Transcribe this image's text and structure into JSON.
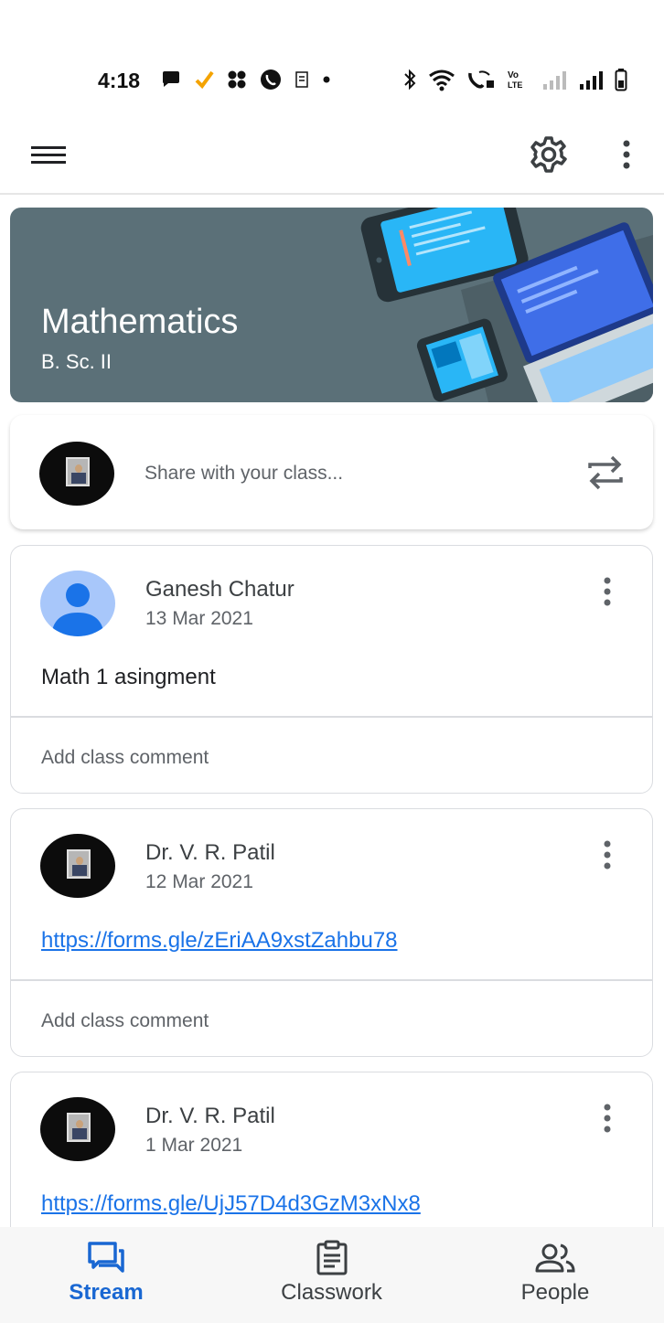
{
  "status_bar": {
    "time": "4:18",
    "left_icons": [
      "chat-bubble-icon",
      "check-icon",
      "app-grid-icon",
      "call-icon",
      "sim-icon",
      "dot-icon"
    ],
    "right_icons": [
      "bluetooth-icon",
      "wifi-icon",
      "wifi-calling-icon",
      "volte-icon",
      "signal-icon",
      "signal-icon",
      "battery-icon"
    ]
  },
  "app_bar": {
    "menu_icon": "hamburger-menu-icon",
    "settings_icon": "gear-icon",
    "more_icon": "more-vert-icon"
  },
  "class_banner": {
    "title": "Mathematics",
    "section": "B. Sc. II",
    "color": "#5b7078"
  },
  "share_box": {
    "placeholder": "Share with your class...",
    "repost_icon": "repost-icon"
  },
  "posts": [
    {
      "author": "Ganesh Chatur",
      "date": "13 Mar 2021",
      "body": "Math 1 asingment",
      "comment_placeholder": "Add class comment"
    },
    {
      "author": "Dr. V. R. Patil",
      "date": "12 Mar 2021",
      "link": "https://forms.gle/zEriAA9xstZahbu78",
      "comment_placeholder": "Add class comment"
    },
    {
      "author": "Dr. V. R. Patil",
      "date": "1 Mar 2021",
      "link": "https://forms.gle/UjJ57D4d3GzM3xNx8"
    }
  ],
  "bottom_nav": {
    "items": [
      {
        "label": "Stream",
        "icon": "stream-icon",
        "active": true
      },
      {
        "label": "Classwork",
        "icon": "classwork-icon",
        "active": false
      },
      {
        "label": "People",
        "icon": "people-icon",
        "active": false
      }
    ],
    "accent": "#1967d2"
  }
}
